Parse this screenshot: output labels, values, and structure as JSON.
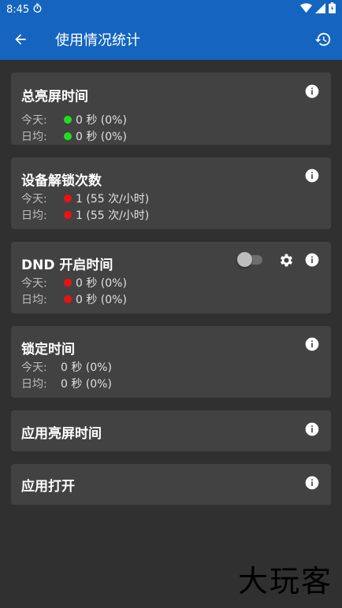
{
  "status_bar": {
    "time": "8:45"
  },
  "app_bar": {
    "title": "使用情况统计"
  },
  "labels": {
    "today": "今天:",
    "daily": "日均:"
  },
  "colors": {
    "green": "#22dd22",
    "red": "#ee1111",
    "accent": "#1565c0"
  },
  "cards": [
    {
      "title": "总亮屏时间",
      "today_value": "0 秒 (0%)",
      "daily_value": "0 秒 (0%)",
      "dot": "green"
    },
    {
      "title": "设备解锁次数",
      "today_value": "1 (55 次/小时)",
      "daily_value": "1 (55 次/小时)",
      "dot": "red"
    },
    {
      "title": "DND 开启时间",
      "today_value": "0 秒 (0%)",
      "daily_value": "0 秒 (0%)",
      "dot": "red",
      "toggle_on": false
    },
    {
      "title": "锁定时间",
      "today_value": "0 秒 (0%)",
      "daily_value": "0 秒 (0%)"
    },
    {
      "title": "应用亮屏时间"
    },
    {
      "title": "应用打开"
    }
  ],
  "watermark": "大玩客"
}
